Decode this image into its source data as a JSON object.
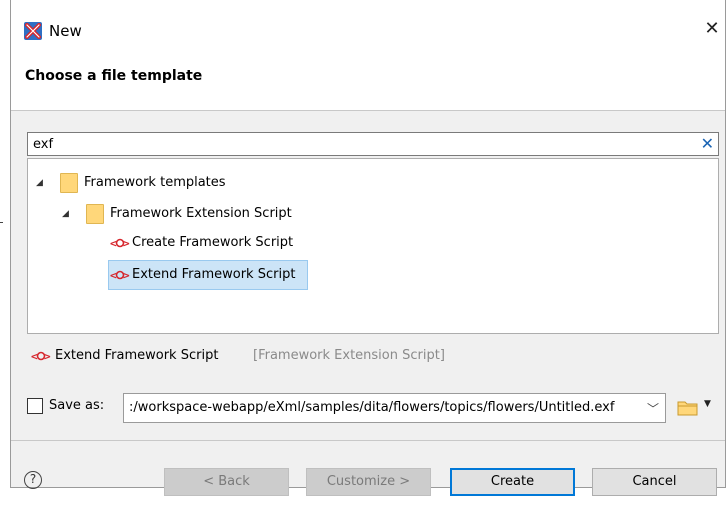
{
  "window": {
    "title": "New",
    "close_label": "✕",
    "app_icon": "oxygen-x-icon",
    "accent": "#d6262d"
  },
  "header": {
    "subtitle": "Choose a file template"
  },
  "search": {
    "value": "exf",
    "clear_label": "✕"
  },
  "tree": {
    "root": {
      "label": "Framework templates",
      "expanded": true
    },
    "child": {
      "label": "Framework Extension Script",
      "expanded": true
    },
    "items": [
      {
        "label": "Create Framework Script",
        "selected": false
      },
      {
        "label": "Extend Framework Script",
        "selected": true
      }
    ]
  },
  "preview": {
    "name": "Extend Framework Script",
    "type": "[Framework Extension Script]"
  },
  "save_as": {
    "label": "Save as:",
    "checked": false,
    "path": ":/workspace-webapp/eXml/samples/dita/flowers/topics/flowers/Untitled.exf"
  },
  "buttons": {
    "help": "?",
    "back": "< Back",
    "customize": "Customize >",
    "create": "Create",
    "cancel": "Cancel"
  },
  "colors": {
    "selection_bg": "#cce4f7",
    "selection_border": "#99c9ef",
    "primary_border": "#0078d7",
    "folder": "#ffd77a",
    "clear_icon": "#1a64b4"
  }
}
